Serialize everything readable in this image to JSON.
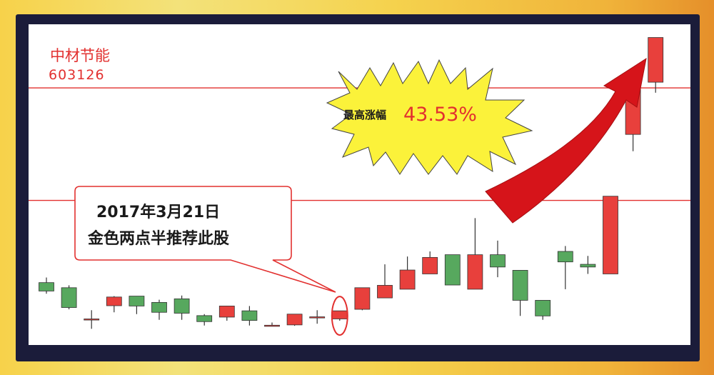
{
  "stock": {
    "name": "中材节能",
    "code": "603126"
  },
  "burst": {
    "label": "最高涨幅",
    "value": "43.53%"
  },
  "callout": {
    "line1": "2017年3月21日",
    "line2": "金色两点半推荐此股"
  },
  "colors": {
    "up": "#e8403c",
    "down": "#57a85e",
    "line": "#e2302f"
  },
  "chart_data": {
    "type": "candlestick",
    "title": "",
    "xlabel": "",
    "ylabel": "",
    "ylim": [
      0,
      100
    ],
    "reference_lines": [
      82.6,
      45.1
    ],
    "highlighted_index": 13,
    "candles": [
      {
        "open": 17.7,
        "close": 14.9,
        "high": 19.4,
        "low": 14.0
      },
      {
        "open": 16.0,
        "close": 9.4,
        "high": 16.8,
        "low": 8.8
      },
      {
        "open": 5.6,
        "close": 5.6,
        "high": 8.5,
        "low": 2.3
      },
      {
        "open": 10.0,
        "close": 12.9,
        "high": 13.2,
        "low": 7.8
      },
      {
        "open": 13.2,
        "close": 9.9,
        "high": 13.2,
        "low": 7.2
      },
      {
        "open": 11.1,
        "close": 7.8,
        "high": 12.0,
        "low": 5.3
      },
      {
        "open": 12.3,
        "close": 7.5,
        "high": 13.4,
        "low": 5.3
      },
      {
        "open": 6.7,
        "close": 4.7,
        "high": 7.2,
        "low": 3.4
      },
      {
        "open": 6.2,
        "close": 9.9,
        "high": 10.0,
        "low": 5.0
      },
      {
        "open": 8.3,
        "close": 5.1,
        "high": 9.9,
        "low": 3.4
      },
      {
        "open": 3.5,
        "close": 3.5,
        "high": 4.4,
        "low": 3.3
      },
      {
        "open": 3.6,
        "close": 7.2,
        "high": 7.2,
        "low": 3.3
      },
      {
        "open": 6.3,
        "close": 6.3,
        "high": 8.5,
        "low": 4.0
      },
      {
        "open": 5.6,
        "close": 8.3,
        "high": 8.3,
        "low": 5.0
      },
      {
        "open": 8.8,
        "close": 16.0,
        "high": 16.0,
        "low": 8.5
      },
      {
        "open": 12.6,
        "close": 16.8,
        "high": 23.8,
        "low": 12.6
      },
      {
        "open": 15.5,
        "close": 21.9,
        "high": 26.4,
        "low": 15.5
      },
      {
        "open": 20.6,
        "close": 26.1,
        "high": 28.1,
        "low": 20.6
      },
      {
        "open": 27.0,
        "close": 16.9,
        "high": 27.0,
        "low": 16.9
      },
      {
        "open": 15.5,
        "close": 27.0,
        "high": 39.2,
        "low": 15.5
      },
      {
        "open": 27.0,
        "close": 22.9,
        "high": 31.7,
        "low": 19.5
      },
      {
        "open": 21.8,
        "close": 11.8,
        "high": 21.8,
        "low": 6.6
      },
      {
        "open": 11.8,
        "close": 6.6,
        "high": 11.8,
        "low": 5.3
      },
      {
        "open": 28.1,
        "close": 24.6,
        "high": 29.9,
        "low": 15.5
      },
      {
        "open": 23.8,
        "close": 22.9,
        "high": 26.6,
        "low": 20.6
      },
      {
        "open": 20.6,
        "close": 46.5,
        "high": 46.5,
        "low": 20.6
      },
      {
        "open": 67.1,
        "close": 85.6,
        "high": 85.6,
        "low": 61.5
      },
      {
        "open": 84.5,
        "close": 99.4,
        "high": 99.4,
        "low": 81.0
      }
    ]
  }
}
